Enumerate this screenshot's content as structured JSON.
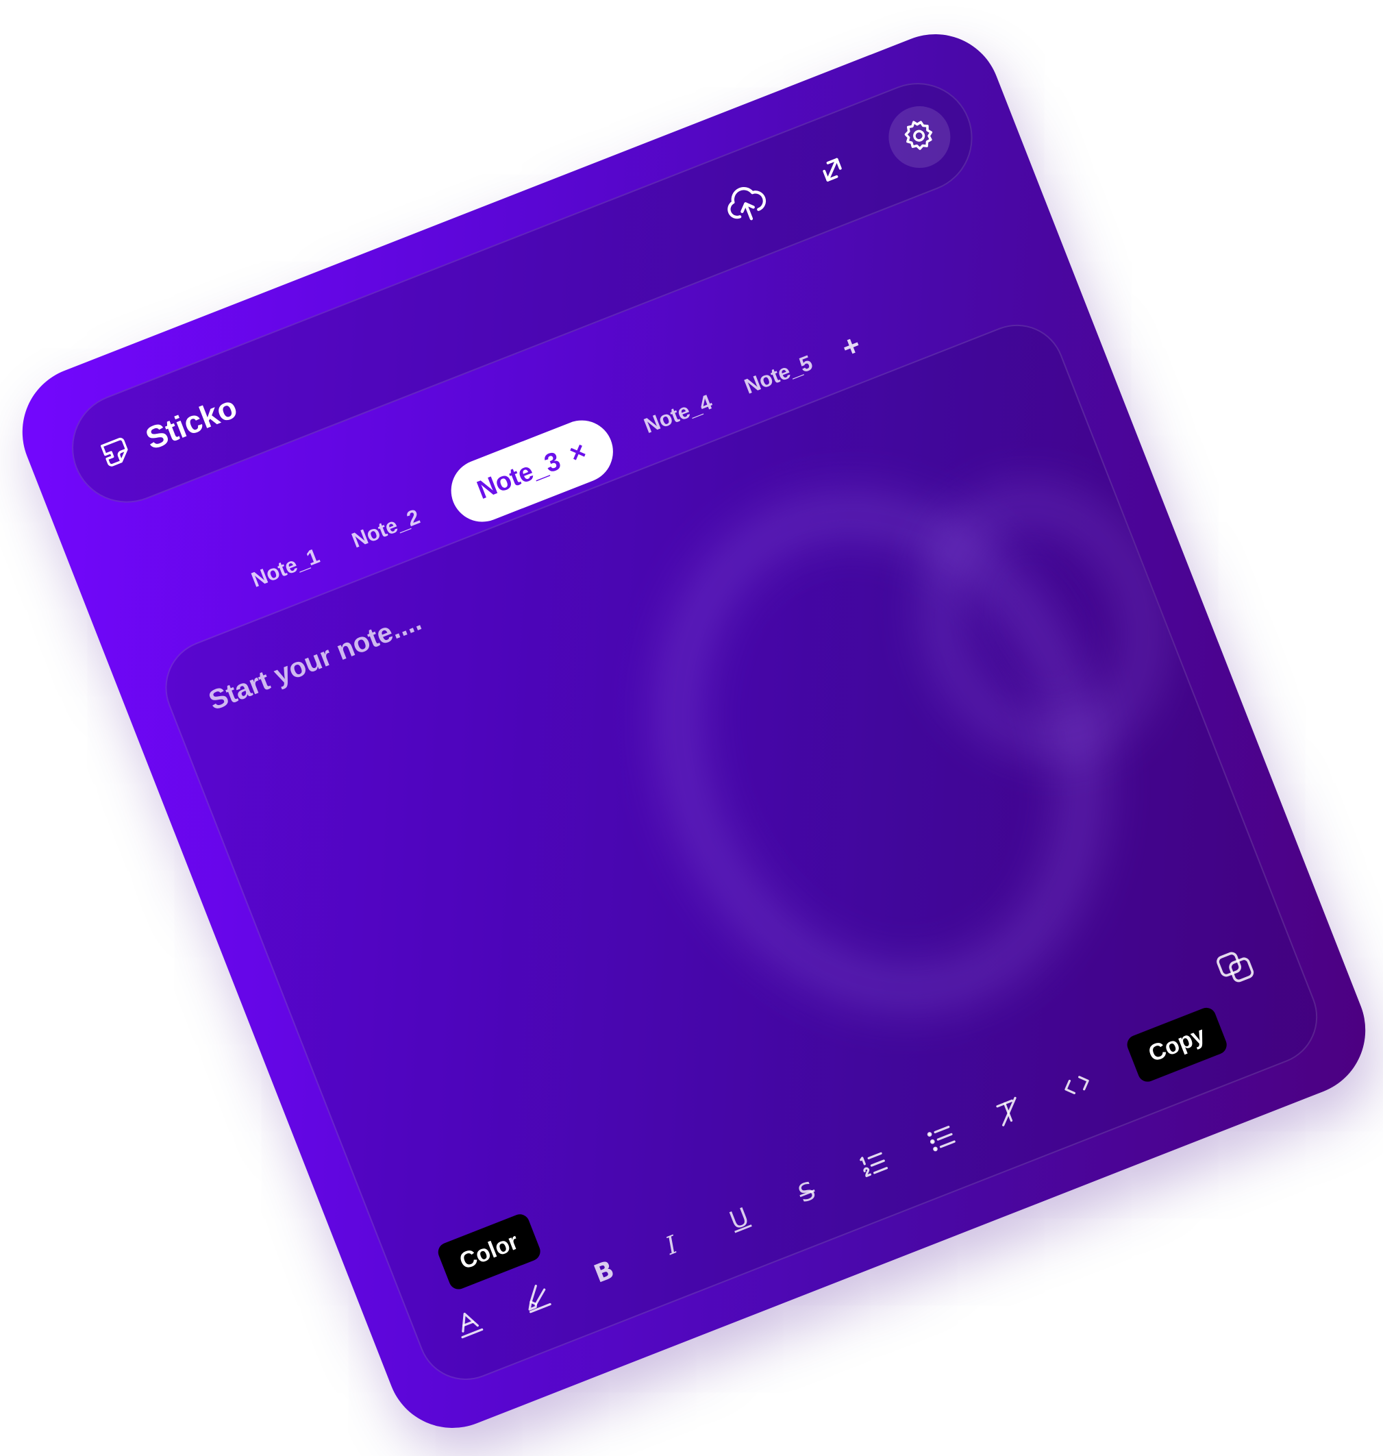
{
  "app": {
    "name": "Sticko",
    "colors": {
      "accent": "#6a10ea",
      "background_start": "#7407ff",
      "background_end": "#4c0080",
      "tooltip_bg": "#000000"
    }
  },
  "header": {
    "actions": [
      {
        "name": "cloud-upload-icon"
      },
      {
        "name": "expand-icon"
      },
      {
        "name": "gear-icon"
      }
    ]
  },
  "tabs": {
    "items": [
      "Note_1",
      "Note_2",
      "Note_3",
      "Note_4",
      "Note_5"
    ],
    "active": "Note_3",
    "close_symbol": "×",
    "add_symbol": "+"
  },
  "editor": {
    "placeholder": "Start your note....",
    "toolbar": {
      "tools": [
        "text-color-icon",
        "highlight-icon",
        "bold-icon",
        "italic-icon",
        "underline-icon",
        "strikethrough-icon",
        "ordered-list-icon",
        "bullet-list-icon",
        "clear-format-icon",
        "code-icon"
      ],
      "bold_label": "B",
      "italic_label": "I",
      "underline_label": "U",
      "strike_label": "S"
    },
    "tooltips": {
      "color": "Color",
      "copy": "Copy"
    }
  }
}
